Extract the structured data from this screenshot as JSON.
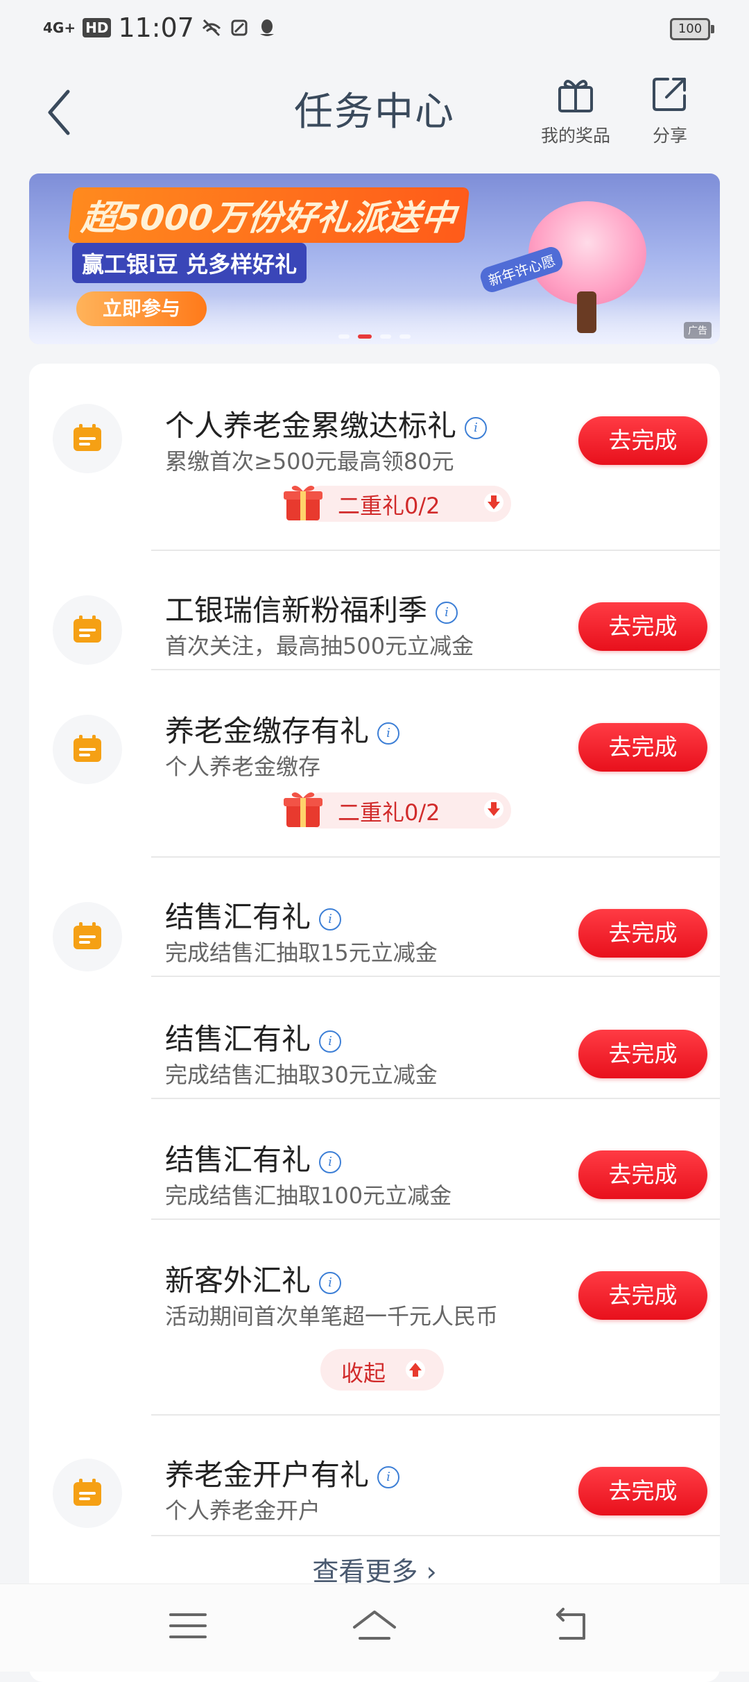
{
  "status_bar": {
    "network": "4G+",
    "hd": "HD",
    "time": "11:07",
    "battery": "100"
  },
  "header": {
    "title": "任务中心",
    "prizes_label": "我的奖品",
    "share_label": "分享"
  },
  "banner": {
    "title": "超5000万份好礼派送中",
    "subtitle": "赢工银i豆 兑多样好礼",
    "cta": "立即参与",
    "badge": "新年许心愿",
    "ad_label": "广告"
  },
  "tasks": [
    {
      "title": "个人养老金累缴达标礼",
      "desc": "累缴首次≥500元最高领80元",
      "button": "去完成",
      "gift": "二重礼0/2"
    },
    {
      "title": "工银瑞信新粉福利季",
      "desc": "首次关注，最高抽500元立减金",
      "button": "去完成"
    },
    {
      "title": "养老金缴存有礼",
      "desc": "个人养老金缴存",
      "button": "去完成",
      "gift": "二重礼0/2"
    },
    {
      "title": "结售汇有礼",
      "desc": "完成结售汇抽取15元立减金",
      "button": "去完成"
    },
    {
      "title": "结售汇有礼",
      "desc": "完成结售汇抽取30元立减金",
      "button": "去完成"
    },
    {
      "title": "结售汇有礼",
      "desc": "完成结售汇抽取100元立减金",
      "button": "去完成"
    },
    {
      "title": "新客外汇礼",
      "desc": "活动期间首次单笔超一千元人民币",
      "button": "去完成"
    },
    {
      "title": "养老金开户有礼",
      "desc": "个人养老金开户",
      "button": "去完成"
    }
  ],
  "collapse_label": "收起",
  "more_label": "查看更多",
  "colors": {
    "accent_red": "#e8101c",
    "icon_orange": "#f5a014",
    "info_blue": "#3d7fd6"
  }
}
